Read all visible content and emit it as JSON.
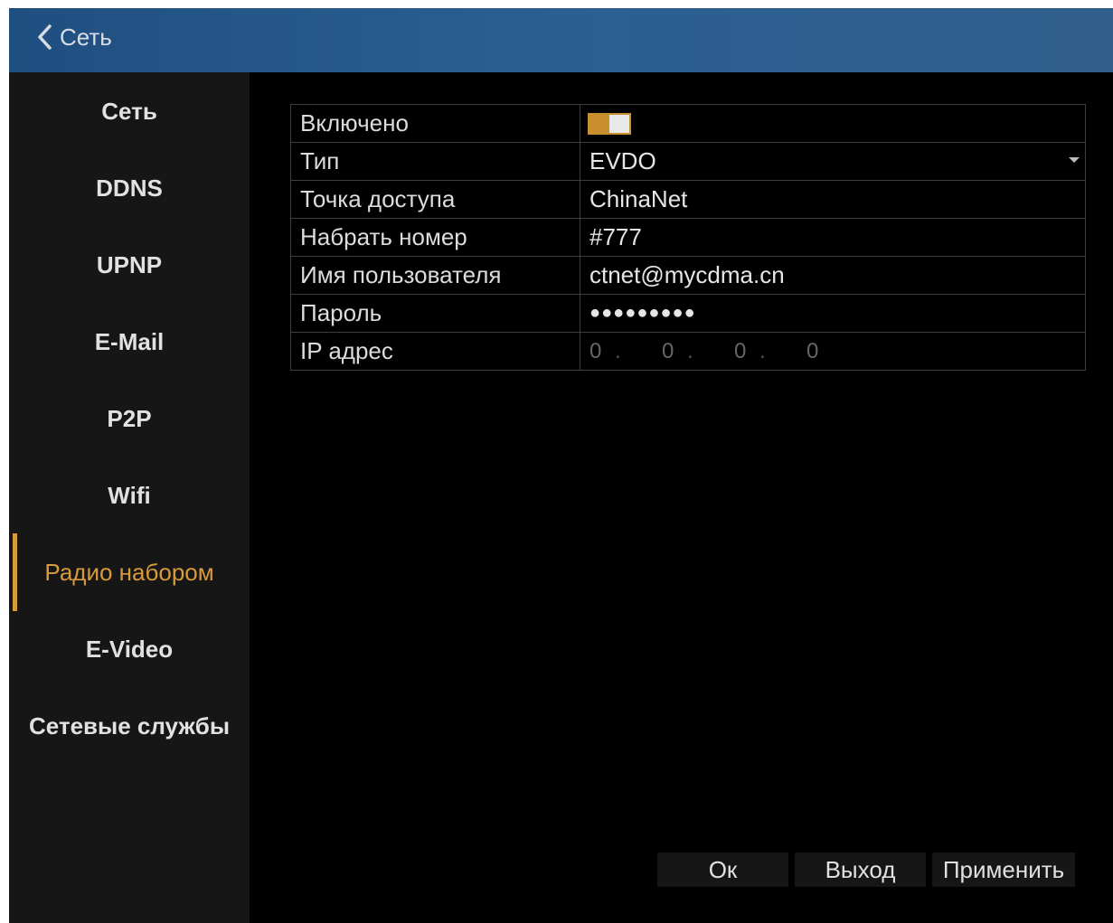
{
  "header": {
    "back_label": "Сеть"
  },
  "sidebar": {
    "items": [
      {
        "label": "Сеть"
      },
      {
        "label": "DDNS"
      },
      {
        "label": "UPNP"
      },
      {
        "label": "E-Mail"
      },
      {
        "label": "P2P"
      },
      {
        "label": "Wifi"
      },
      {
        "label": "Радио набором",
        "active": true
      },
      {
        "label": "E-Video"
      },
      {
        "label": "Сетевые службы"
      }
    ]
  },
  "form": {
    "enabled": {
      "label": "Включено",
      "value": true
    },
    "type": {
      "label": "Тип",
      "value": "EVDO"
    },
    "access_point": {
      "label": "Точка доступа",
      "value": "ChinaNet"
    },
    "dial_number": {
      "label": "Набрать номер",
      "value": "#777"
    },
    "username": {
      "label": "Имя пользователя",
      "value": "ctnet@mycdma.cn"
    },
    "password": {
      "label": "Пароль",
      "value": "●●●●●●●●●"
    },
    "ip_address": {
      "label": "IP адрес",
      "octets": [
        "0",
        "0",
        "0",
        "0"
      ],
      "separator": "."
    }
  },
  "buttons": {
    "ok": "Ок",
    "exit": "Выход",
    "apply": "Применить"
  },
  "colors": {
    "accent": "#d89a3a",
    "header_bg": "#2b5f92",
    "sidebar_bg": "#161616",
    "content_bg": "#000000",
    "grid_line": "#3e3e3e"
  }
}
